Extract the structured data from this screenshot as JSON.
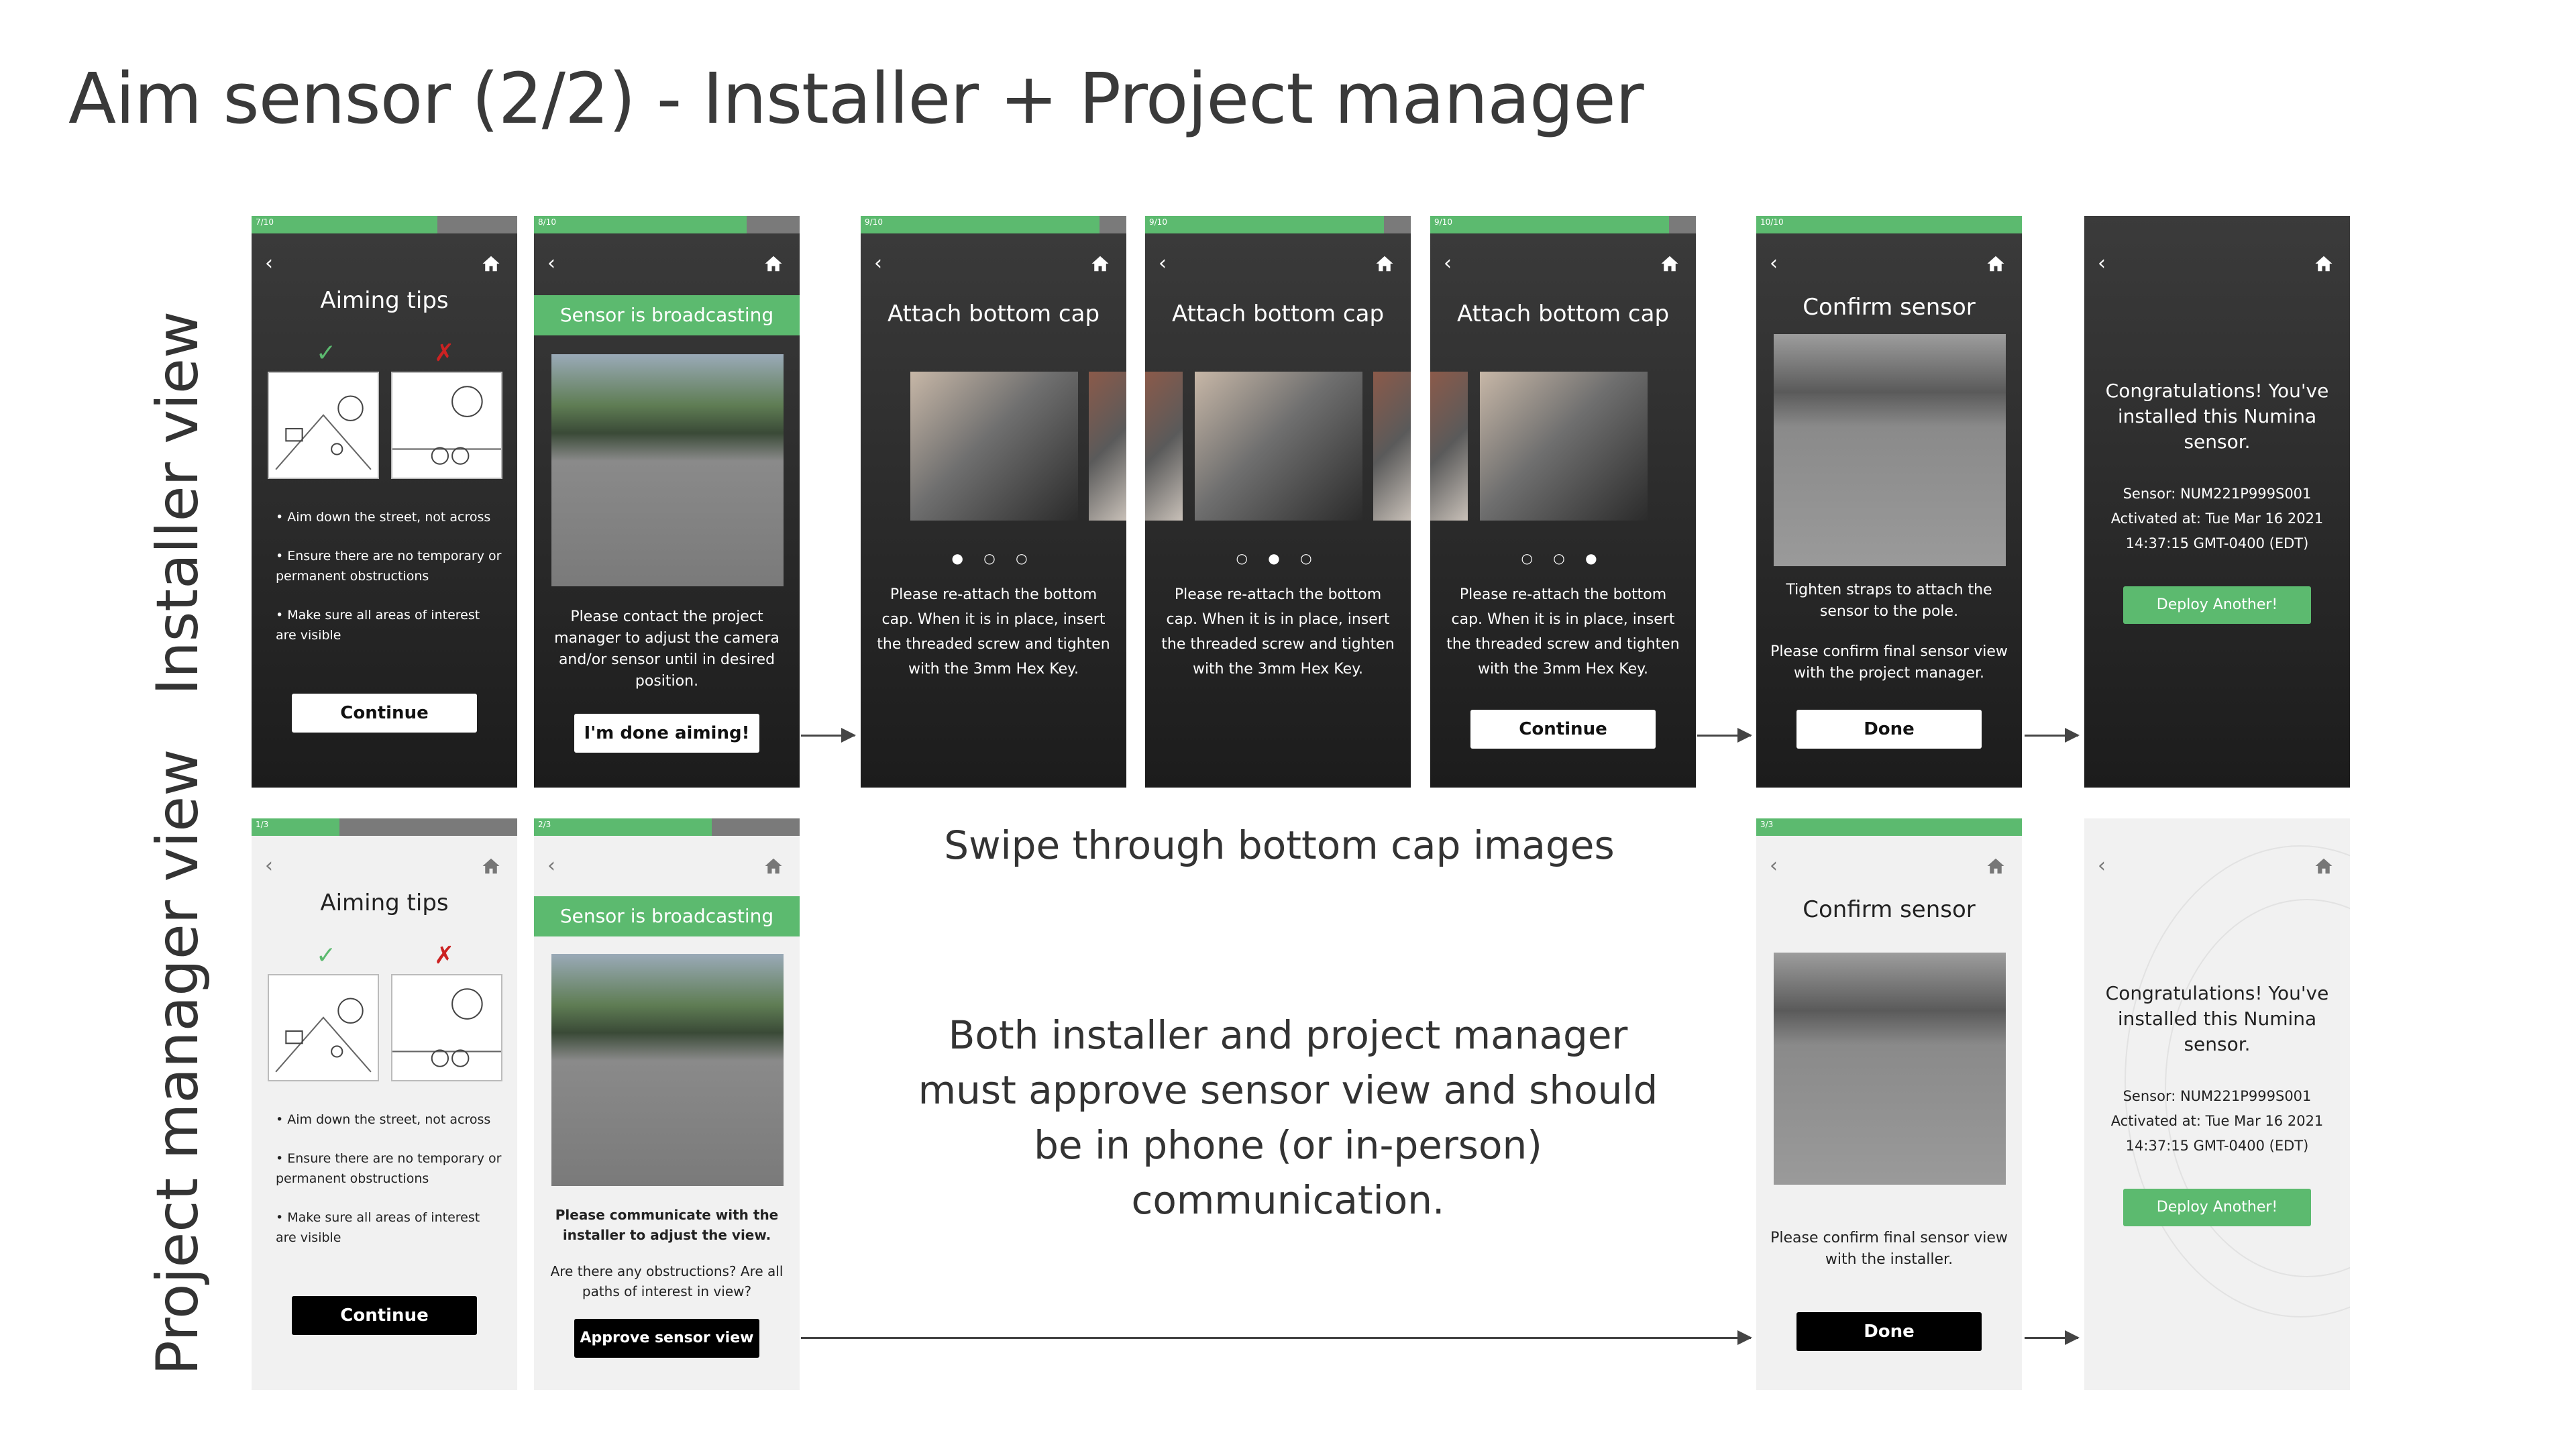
{
  "page": {
    "title": "Aim sensor (2/2) - Installer + Project manager"
  },
  "row_labels": {
    "installer": "Installer view",
    "project_manager": "Project manager view"
  },
  "common": {
    "aiming_title": "Aiming tips",
    "check": "✓",
    "cross": "✗",
    "tips": [
      "• Aim down the street, not across",
      "• Ensure there are no temporary or permanent obstructions",
      "• Make sure all areas of interest are visible"
    ],
    "continue": "Continue",
    "broadcast": "Sensor is broadcasting",
    "attach_title": "Attach bottom cap",
    "attach_body": "Please re-attach the bottom cap. When it is in place, insert the threaded screw and tighten with the 3mm Hex Key.",
    "confirm_title": "Confirm sensor",
    "done": "Done",
    "congrats": "Congratulations! You've installed this Numina sensor.",
    "sensor_id": "Sensor: NUM221P999S001",
    "activated": "Activated at: Tue Mar 16 2021",
    "time": "14:37:15 GMT-0400 (EDT)",
    "deploy": "Deploy Another!",
    "back_icon": "chevron-left-icon",
    "home_icon": "home-icon"
  },
  "installer": {
    "s1": {
      "progress": "7/10",
      "fill": 0.7
    },
    "s2": {
      "progress": "8/10",
      "fill": 0.8,
      "body": "Please contact the project manager to adjust the camera and/or sensor until in desired position.",
      "button": "I'm done aiming!"
    },
    "s3": {
      "progress": "9/10",
      "fill": 0.9,
      "dots": "● ○ ○"
    },
    "s4": {
      "progress": "9/10",
      "fill": 0.9,
      "dots": "○ ● ○"
    },
    "s5": {
      "progress": "9/10",
      "fill": 0.9,
      "dots": "○ ○ ●"
    },
    "s6": {
      "progress": "10/10",
      "fill": 1.0,
      "body1": "Tighten straps to attach the sensor to the pole.",
      "body2": "Please confirm final sensor view with the project manager."
    },
    "s7": {
      "progress": "",
      "fill": 0
    }
  },
  "pm": {
    "s1": {
      "progress": "1/3",
      "fill": 0.33
    },
    "s2": {
      "progress": "2/3",
      "fill": 0.67,
      "body1": "Please communicate with the installer to adjust the view.",
      "body2": "Are there any obstructions? Are all paths of interest in view?",
      "button": "Approve sensor view"
    },
    "s3": {
      "progress": "3/3",
      "fill": 1.0,
      "body": "Please confirm final sensor view with the installer."
    },
    "s4": {
      "progress": "",
      "fill": 0
    }
  },
  "captions": {
    "swipe": "Swipe through bottom cap images",
    "approve": "Both installer and project manager must approve sensor view and should be in phone (or in-person) communication."
  },
  "colors": {
    "accent": "#5cba6f",
    "dark_screen": "#262626",
    "light_screen": "#f1f1f1",
    "error": "#cc2222"
  }
}
